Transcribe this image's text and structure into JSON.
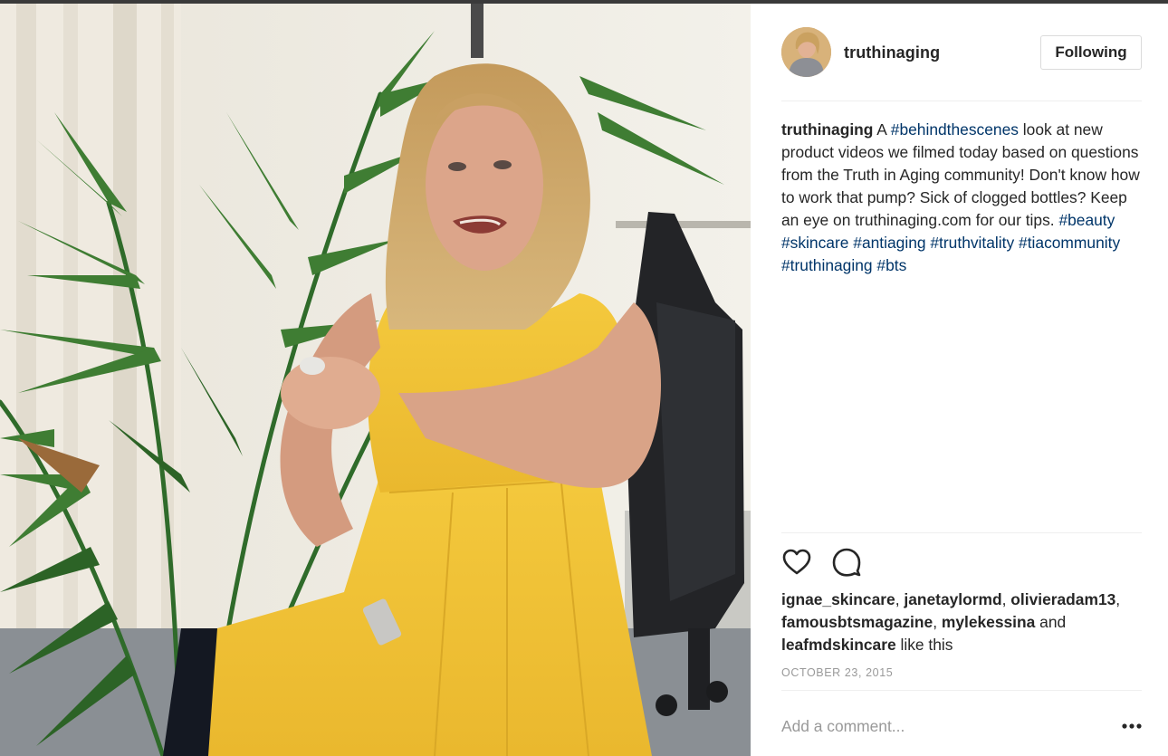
{
  "post": {
    "author": "truthinaging",
    "follow_label": "Following",
    "caption": {
      "author": "truthinaging",
      "text_1": " A ",
      "tag_1": "#behindthescenes",
      "text_2": " look at new product videos we filmed today based on questions from the Truth in Aging community! Don't know how to work that pump? Sick of clogged bottles? Keep an eye on truthinaging.com for our tips. ",
      "tag_2": "#beauty",
      "tag_3": "#skincare",
      "tag_4": "#antiaging",
      "tag_5": "#truthvitality",
      "tag_6": "#tiacommunity",
      "tag_7": "#truthinaging",
      "tag_8": "#bts"
    },
    "likes": {
      "users": [
        "ignae_skincare",
        "janetaylormd",
        "olivieradam13",
        "famousbtsmagazine",
        "mylekessina",
        "leafmdskincare"
      ],
      "sep": ", ",
      "and_text": " and ",
      "suffix": " like this"
    },
    "date": "OCTOBER 23, 2015",
    "comment_placeholder": "Add a comment...",
    "icons": {
      "like": "heart-icon",
      "comment": "comment-bubble-icon",
      "more": "more-options-icon"
    }
  },
  "colors": {
    "hashtag": "#003569",
    "text": "#262626",
    "muted": "#999999",
    "border": "#dbdbdb",
    "dress": "#f2c53b"
  }
}
